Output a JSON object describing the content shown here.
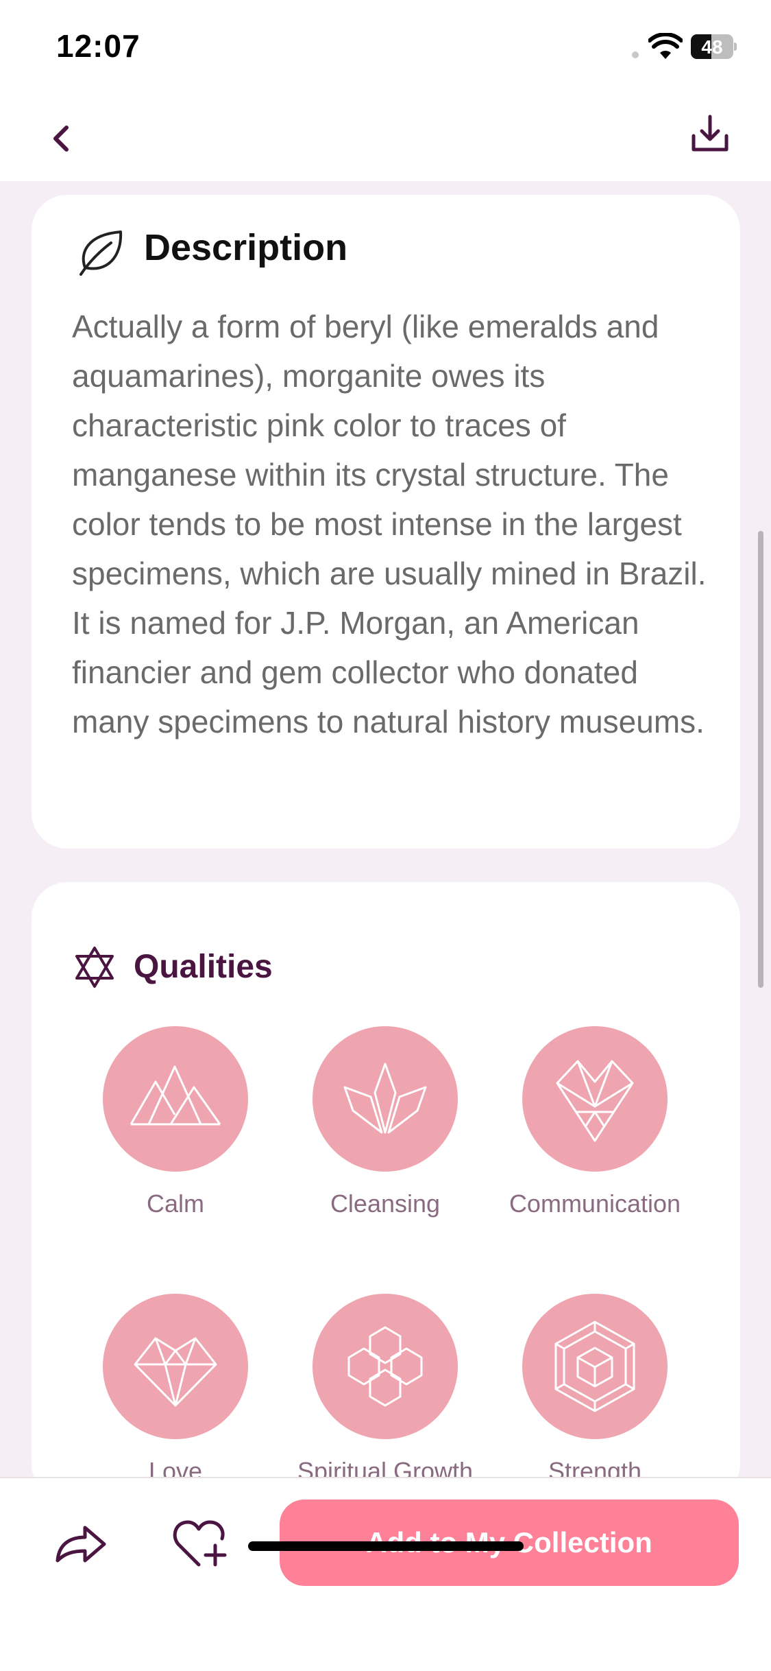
{
  "status_bar": {
    "time": "12:07",
    "battery": "48",
    "battery_level": 0.48
  },
  "nav": {
    "back_icon": "chevron-left-icon",
    "download_icon": "download-icon"
  },
  "description": {
    "icon": "leaf-icon",
    "title": "Description",
    "text": "Actually a form of beryl (like emeralds and aquamarines), morganite owes its characteristic pink color to traces of manganese within its crystal structure. The color tends to be most intense in the largest specimens, which are usually mined in Brazil. It is named for J.P. Morgan, an American financier and gem collector who donated many specimens to natural history museums."
  },
  "qualities": {
    "icon": "star-of-david-icon",
    "title": "Qualities",
    "items": [
      {
        "label": "Calm",
        "icon": "mountains-icon"
      },
      {
        "label": "Cleansing",
        "icon": "crystals-icon"
      },
      {
        "label": "Communication",
        "icon": "geometric-heart-icon"
      },
      {
        "label": "Love",
        "icon": "faceted-heart-icon"
      },
      {
        "label": "Spiritual Growth",
        "icon": "hexagon-flower-icon"
      },
      {
        "label": "Strength",
        "icon": "cube-hexagon-icon"
      }
    ]
  },
  "bottom_bar": {
    "share_icon": "share-arrow-icon",
    "favorite_icon": "heart-plus-icon",
    "add_button_label": "Add to My Collection"
  },
  "colors": {
    "accent": "#ff8197",
    "quality_circle": "#efa5b0",
    "brand_dark": "#4a1540",
    "background": "#f5eff5"
  }
}
